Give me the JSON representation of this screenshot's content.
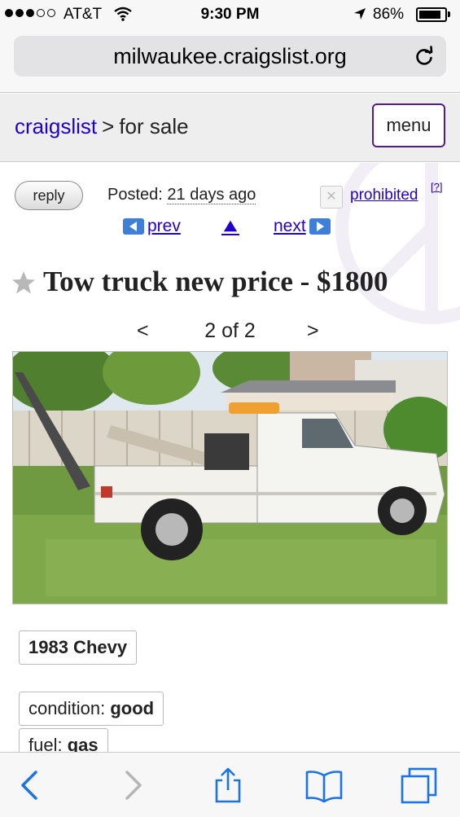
{
  "status_bar": {
    "carrier": "AT&T",
    "time": "9:30 PM",
    "battery": "86%",
    "battery_level": 0.86,
    "signal_bars_filled": 3,
    "signal_bars_total": 5
  },
  "browser": {
    "url": "milwaukee.craigslist.org"
  },
  "header": {
    "home_link": "craigslist",
    "separator": ">",
    "category": "for sale",
    "menu_label": "menu"
  },
  "posting": {
    "reply_label": "reply",
    "posted_label": "Posted:",
    "posted_value": "21 days ago",
    "flag_label": "prohibited",
    "help_label": "[?]",
    "prev_label": "prev",
    "next_label": "next",
    "title": "Tow truck new price - $1800",
    "gallery": {
      "prev": "<",
      "count": "2 of 2",
      "next": ">"
    },
    "attributes": {
      "vehicle": "1983 Chevy",
      "condition_label": "condition:",
      "condition_value": "good",
      "fuel_label": "fuel:",
      "fuel_value": "gas"
    }
  },
  "colors": {
    "link": "#2200cc",
    "menu_border": "#551a8b",
    "header_bg": "#eeeeee"
  },
  "icons": {
    "reload": "reload-icon",
    "star": "star-icon",
    "back": "back-icon",
    "forward": "forward-icon",
    "share": "share-icon",
    "bookmarks": "bookmarks-icon",
    "tabs": "tabs-icon"
  }
}
